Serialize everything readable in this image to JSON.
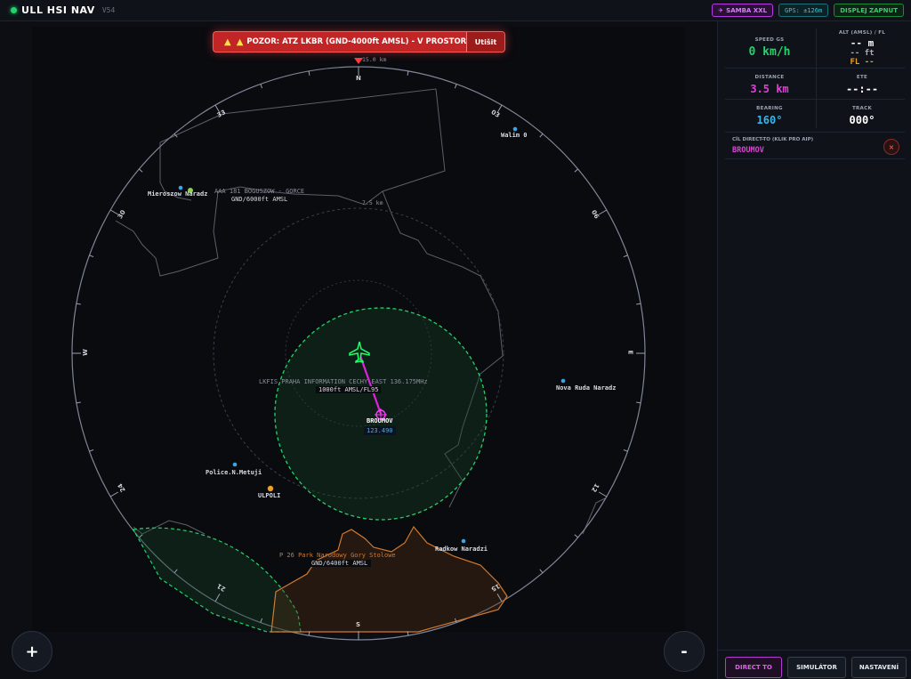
{
  "app": {
    "title": "ULL HSI NAV",
    "version": "V54"
  },
  "badges": {
    "samba": "SAMBA XXL",
    "gps": "GPS: ±126m",
    "display": "DISPLEJ ZAPNUT"
  },
  "alert": {
    "text": "POZOR: ATZ LKBR (GND-4000ft AMSL) - V PROSTORU!",
    "mute_label": "Utišit"
  },
  "map": {
    "range_outer": "15.0 km",
    "range_inner": "7.5 km",
    "compass": {
      "n": "N",
      "e": "E",
      "s": "S",
      "w": "W",
      "t03": "03",
      "t06": "06",
      "t12": "12",
      "t15": "15",
      "t21": "21",
      "t24": "24",
      "t30": "30",
      "t33": "33"
    },
    "airspace": [
      {
        "name": "AAA 181 BOGUSZOW - GORCE",
        "limits": "GND/6000ft AMSL"
      },
      {
        "name": "LKFIS PRAHA INFORMATION CECHY EAST 136.175MHz",
        "limits": "1000ft AMSL/FL95"
      },
      {
        "name": "P 26 Park Narodowy Gory Stolowe",
        "limits": "GND/6400ft AMSL"
      }
    ],
    "waypoints": [
      {
        "name": "Walim 0"
      },
      {
        "name": "Mieroszow Naradz"
      },
      {
        "name": "Nova Ruda Naradz"
      },
      {
        "name": "Police.N.Metuji"
      },
      {
        "name": "ULPOLI"
      },
      {
        "name": "Radkow Naradzi"
      }
    ],
    "target": {
      "name": "BROUMOV",
      "freq": "123.490"
    },
    "zoom_in": "+",
    "zoom_out": "-",
    "colors": {
      "atz": "#22d36a",
      "prohibited": "#d2792e",
      "route": "#e020e0"
    }
  },
  "panel": {
    "speed": {
      "label": "SPEED GS",
      "value": "0 km/h"
    },
    "alt": {
      "label": "ALT (AMSL) / FL",
      "m": "-- m",
      "ft": "-- ft",
      "fl": "FL --"
    },
    "distance": {
      "label": "DISTANCE",
      "value": "3.5 km"
    },
    "ete": {
      "label": "ETE",
      "value": "--:--"
    },
    "bearing": {
      "label": "BEARING",
      "value": "160°"
    },
    "track": {
      "label": "TRACK",
      "value": "000°"
    },
    "target_label": "CÍL DIRECT-TO (KLIK PRO AIP)",
    "target_value": "BROUMOV",
    "close": "×",
    "buttons": {
      "direct": "DIRECT TO",
      "sim": "SIMULÁTOR",
      "settings": "NASTAVENÍ"
    }
  }
}
